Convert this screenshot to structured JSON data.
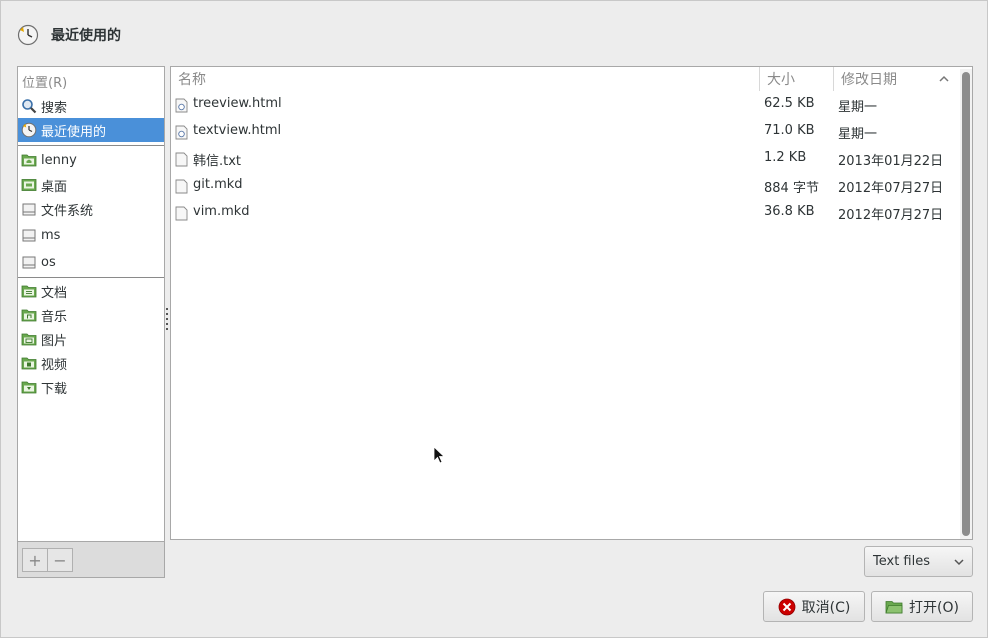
{
  "window": {
    "title": "最近使用的"
  },
  "sidebar": {
    "heading": "位置(R)",
    "items": [
      {
        "label": "搜索",
        "icon": "search-icon"
      },
      {
        "label": "最近使用的",
        "icon": "recent-icon",
        "selected": true
      },
      {
        "label": "lenny",
        "icon": "home-folder-icon"
      },
      {
        "label": "桌面",
        "icon": "desktop-icon"
      },
      {
        "label": "文件系统",
        "icon": "drive-icon"
      },
      {
        "label": "ms",
        "icon": "drive-icon"
      },
      {
        "label": "os",
        "icon": "drive-icon"
      },
      {
        "label": "文档",
        "icon": "documents-folder-icon"
      },
      {
        "label": "音乐",
        "icon": "music-folder-icon"
      },
      {
        "label": "图片",
        "icon": "pictures-folder-icon"
      },
      {
        "label": "视频",
        "icon": "videos-folder-icon"
      },
      {
        "label": "下载",
        "icon": "downloads-folder-icon"
      }
    ],
    "add_label": "+",
    "remove_label": "−"
  },
  "filelist": {
    "columns": {
      "name": "名称",
      "size": "大小",
      "modified": "修改日期"
    },
    "rows": [
      {
        "name": "treeview.html",
        "size": "62.5 KB",
        "modified": "星期一",
        "icon": "html-file-icon"
      },
      {
        "name": "textview.html",
        "size": "71.0 KB",
        "modified": "星期一",
        "icon": "html-file-icon"
      },
      {
        "name": "韩信.txt",
        "size": "1.2 KB",
        "modified": "2013年01月22日",
        "icon": "text-file-icon"
      },
      {
        "name": "git.mkd",
        "size": "884 字节",
        "modified": "2012年07月27日",
        "icon": "text-file-icon"
      },
      {
        "name": "vim.mkd",
        "size": "36.8 KB",
        "modified": "2012年07月27日",
        "icon": "text-file-icon"
      }
    ]
  },
  "filter": {
    "selected": "Text files"
  },
  "actions": {
    "cancel": "取消(C)",
    "open": "打开(O)"
  },
  "colors": {
    "selection": "#4a90d9",
    "cancel_red": "#cc0000",
    "folder_green": "#6aa84f"
  }
}
